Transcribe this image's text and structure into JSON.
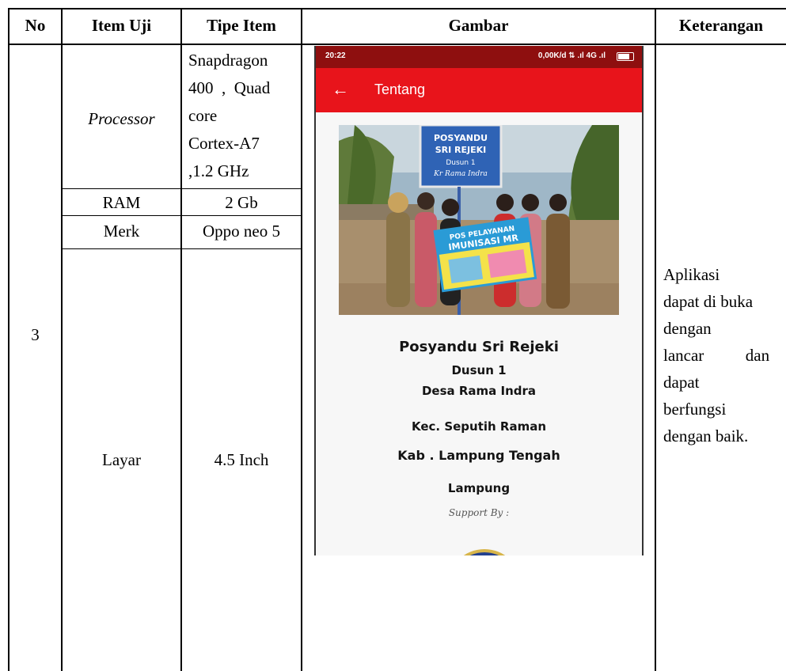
{
  "table": {
    "headers": [
      "No",
      "Item Uji",
      "Tipe Item",
      "Gambar",
      "Keterangan"
    ],
    "no": "3",
    "rows": [
      {
        "item": "Processor",
        "tipe_lines": [
          "Snapdragon",
          "400  ,  Quad",
          "core",
          "Cortex-A7",
          ",1.2 GHz"
        ]
      },
      {
        "item": "RAM",
        "tipe": "2 Gb"
      },
      {
        "item": "Merk",
        "tipe": "Oppo neo 5"
      },
      {
        "item": "Layar",
        "tipe": "4.5 Inch"
      }
    ],
    "keterangan_lines": [
      "Aplikasi",
      "dapat di buka",
      "dengan",
      "lancar          dan",
      "dapat",
      "berfungsi",
      "dengan baik."
    ]
  },
  "phone": {
    "status_time": "20:22",
    "status_right": "0,00K/d  ⇅ .ıl 4G .ıl",
    "appbar_title": "Tentang",
    "back_icon": "arrow-left-icon",
    "sign_text": [
      "POSYANDU",
      "SRI REJEKI",
      "Dusun 1",
      "Kr Rama Indra"
    ],
    "banner_text": [
      "POS PELAYANAN",
      "IMUNISASI MR"
    ],
    "title": "Posyandu Sri Rejeki",
    "line1": "Dusun 1",
    "line2": "Desa Rama Indra",
    "line3": "Kec. Seputih Raman",
    "line4": "Kab . Lampung Tengah",
    "line5": "Lampung",
    "support": "Support By :",
    "colors": {
      "appbar": "#e8141b",
      "statusbar": "#8e0f0f"
    }
  }
}
